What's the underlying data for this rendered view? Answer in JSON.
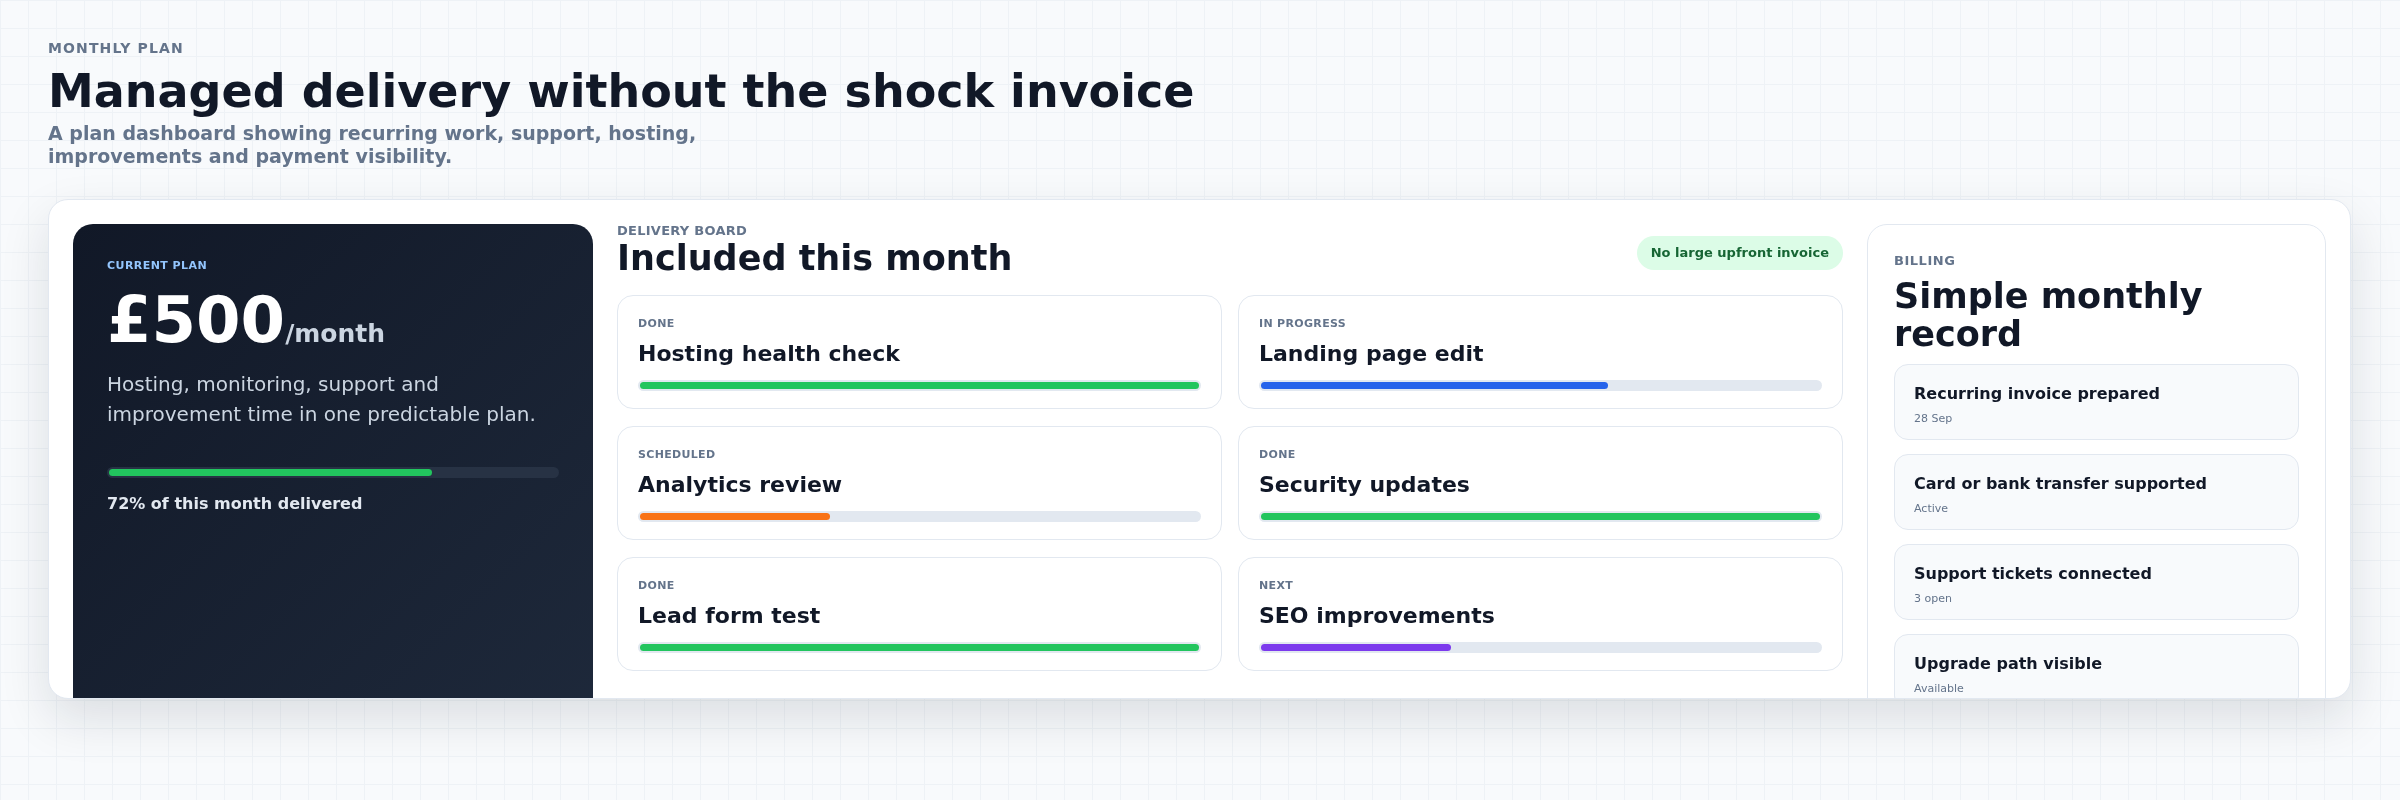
{
  "header": {
    "eyebrow": "MONTHLY PLAN",
    "title": "Managed delivery without the shock invoice",
    "subtitle": "A plan dashboard showing recurring work, support, hosting, improvements and payment visibility."
  },
  "plan": {
    "eyebrow": "CURRENT PLAN",
    "price": "£500",
    "period": "/month",
    "description": "Hosting, monitoring, support and improvement time in one predictable plan.",
    "progress": {
      "level": 0.72,
      "caption": "72% of this month delivered"
    }
  },
  "board": {
    "eyebrow": "DELIVERY BOARD",
    "title": "Included this month",
    "badge": "No large upfront invoice",
    "tasks": [
      {
        "status": "DONE",
        "title": "Hosting health check",
        "level": 1,
        "color": "#22c55e"
      },
      {
        "status": "IN PROGRESS",
        "title": "Landing page edit",
        "level": 0.62,
        "color": "#2563eb"
      },
      {
        "status": "SCHEDULED",
        "title": "Analytics review",
        "level": 0.34,
        "color": "#f97316"
      },
      {
        "status": "DONE",
        "title": "Security updates",
        "level": 1,
        "color": "#22c55e"
      },
      {
        "status": "DONE",
        "title": "Lead form test",
        "level": 1,
        "color": "#22c55e"
      },
      {
        "status": "NEXT",
        "title": "SEO improvements",
        "level": 0.34,
        "color": "#7c3aed"
      }
    ]
  },
  "billing": {
    "eyebrow": "BILLING",
    "title": "Simple monthly record",
    "items": [
      {
        "title": "Recurring invoice prepared",
        "detail": "28 Sep"
      },
      {
        "title": "Card or bank transfer supported",
        "detail": "Active"
      },
      {
        "title": "Support tickets connected",
        "detail": "3 open"
      },
      {
        "title": "Upgrade path visible",
        "detail": "Available"
      }
    ]
  }
}
